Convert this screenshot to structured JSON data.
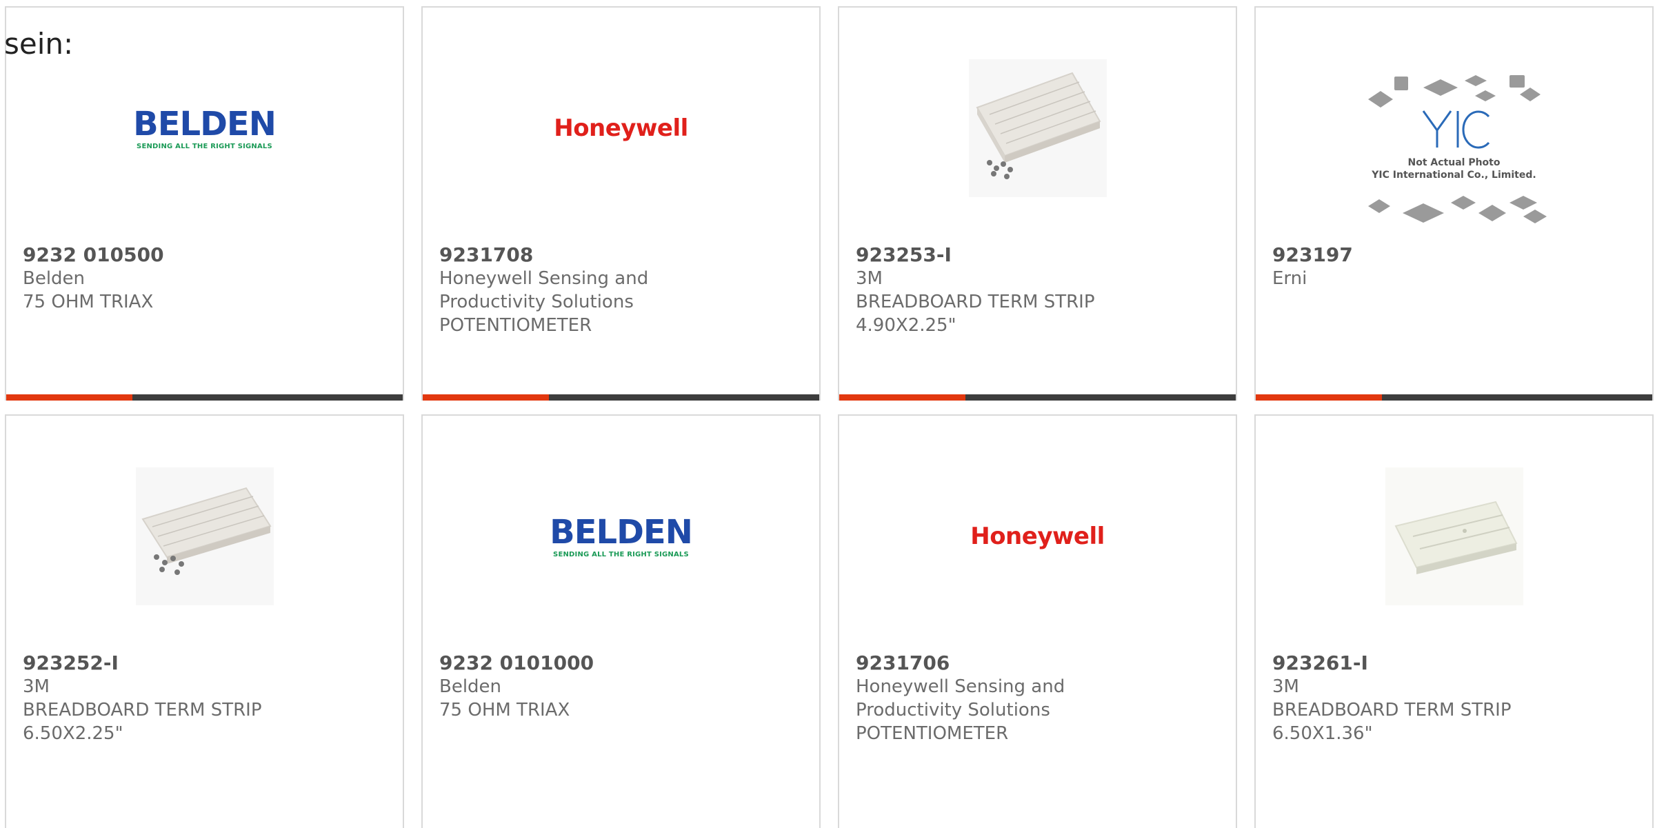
{
  "lead_text": "sein:",
  "products": [
    {
      "part_number": "9232 010500",
      "manufacturer": "Belden",
      "description_lines": [
        "75 OHM TRIAX"
      ],
      "image": "belden-logo",
      "image_text": {
        "word": "BELDEN",
        "tagline": "SENDING ALL THE RIGHT SIGNALS"
      }
    },
    {
      "part_number": "9231708",
      "manufacturer": "Honeywell Sensing and",
      "description_lines": [
        "Productivity Solutions",
        "POTENTIOMETER"
      ],
      "image": "honeywell-logo",
      "image_text": {
        "word": "Honeywell"
      }
    },
    {
      "part_number": "923253-I",
      "manufacturer": "3M",
      "description_lines": [
        "BREADBOARD TERM STRIP",
        "4.90X2.25\""
      ],
      "image": "breadboard-photo"
    },
    {
      "part_number": "923197",
      "manufacturer": "Erni",
      "description_lines": [],
      "image": "yic-placeholder",
      "image_text": {
        "line1": "Not Actual Photo",
        "line2": "YIC International Co., Limited."
      }
    },
    {
      "part_number": "923252-I",
      "manufacturer": "3M",
      "description_lines": [
        "BREADBOARD TERM STRIP",
        "6.50X2.25\""
      ],
      "image": "breadboard-photo"
    },
    {
      "part_number": "9232 0101000",
      "manufacturer": "Belden",
      "description_lines": [
        "75 OHM TRIAX"
      ],
      "image": "belden-logo",
      "image_text": {
        "word": "BELDEN",
        "tagline": "SENDING ALL THE RIGHT SIGNALS"
      }
    },
    {
      "part_number": "9231706",
      "manufacturer": "Honeywell Sensing and",
      "description_lines": [
        "Productivity Solutions",
        "POTENTIOMETER"
      ],
      "image": "honeywell-logo",
      "image_text": {
        "word": "Honeywell"
      }
    },
    {
      "part_number": "923261-I",
      "manufacturer": "3M",
      "description_lines": [
        "BREADBOARD TERM STRIP",
        "6.50X1.36\""
      ],
      "image": "term-strip-photo"
    }
  ],
  "colors": {
    "accent": "#e2380f",
    "bar": "#3d3d3d",
    "card_border": "#d9d9d9",
    "belden_blue": "#1f4aa8",
    "belden_green": "#1a9a56",
    "honeywell_red": "#e0201b"
  }
}
